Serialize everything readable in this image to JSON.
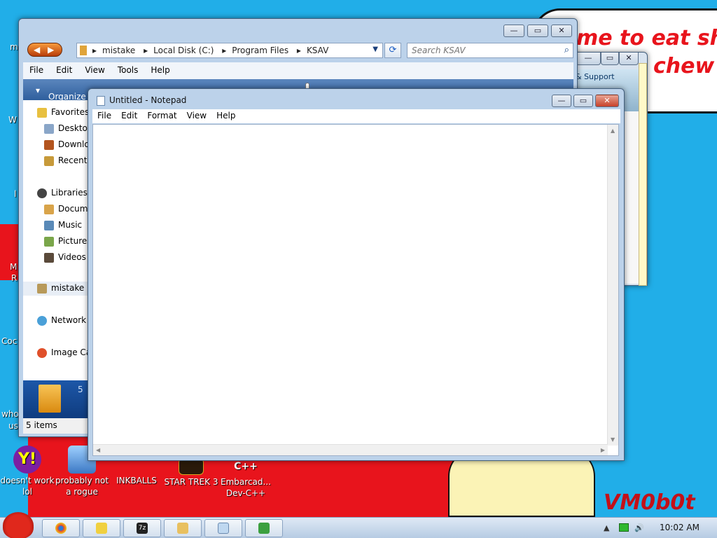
{
  "desktop": {
    "bubble_line1": "me to eat shit",
    "bubble_line2": "chew",
    "corner_tag": "VM0b0t",
    "icons": [
      {
        "label": "doesn't work lol"
      },
      {
        "label": "probably not a rogue"
      },
      {
        "label": "INKBALLS"
      },
      {
        "label": "STAR TREK 3"
      },
      {
        "label": "Embarcad... Dev-C++"
      }
    ],
    "left_labels": [
      "m",
      "W",
      "l",
      "M",
      "R",
      "Coc",
      "who",
      "us"
    ],
    "back_window": {
      "text": "& Support"
    }
  },
  "explorer": {
    "breadcrumbs": [
      "mistake",
      "Local Disk (C:)",
      "Program Files",
      "KSAV"
    ],
    "search_placeholder": "Search KSAV",
    "menu": [
      "File",
      "Edit",
      "View",
      "Tools",
      "Help"
    ],
    "organize_label": "Organize",
    "sidebar": {
      "favorites": "Favorites",
      "desktop": "Deskto",
      "downloads": "Downlo",
      "recent": "Recent",
      "libraries": "Libraries",
      "documents": "Docum",
      "music": "Music",
      "pictures": "Pictures",
      "videos": "Videos",
      "homegroup": "mistake",
      "network": "Network",
      "image": "Image Ca"
    },
    "details_text": "5",
    "status": "5 items"
  },
  "notepad": {
    "title": "Untitled - Notepad",
    "menu": [
      "File",
      "Edit",
      "Format",
      "View",
      "Help"
    ],
    "content": ""
  },
  "taskbar": {
    "clock": "10:02 AM"
  }
}
